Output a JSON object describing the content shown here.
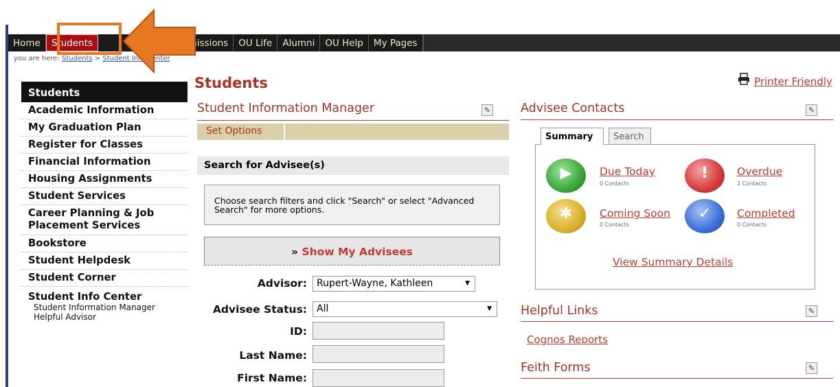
{
  "nav": {
    "items": [
      "Home",
      "Students",
      "Admissions",
      "OU Life",
      "Alumni",
      "OU Help",
      "My Pages"
    ]
  },
  "breadcrumb": {
    "prefix": "you are here:",
    "link1": "Students",
    "sep": ">",
    "link2": "Student Info Center"
  },
  "sidebar": {
    "items": [
      "Students",
      "Academic Information",
      "My Graduation Plan",
      "Register for Classes",
      "Financial Information",
      "Housing Assignments",
      "Student Services",
      "Career Planning & Job Placement Services",
      "Bookstore",
      "Student Helpdesk",
      "Student Corner",
      "Student Info Center"
    ],
    "subitems": [
      "Student Information Manager",
      "Helpful Advisor"
    ]
  },
  "page": {
    "title": "Students",
    "printer_label": "Printer Friendly"
  },
  "sim": {
    "title": "Student Information Manager",
    "set_options": "Set Options",
    "search_heading": "Search for Advisee(s)",
    "info_text": "Choose search filters and click \"Search\" or select \"Advanced Search\" for more options.",
    "show_label": "Show My Advisees",
    "show_chevron": "»",
    "advisor_label": "Advisor:",
    "advisor_value": "Rupert-Wayne, Kathleen",
    "status_label": "Advisee Status:",
    "status_value": "All",
    "id_label": "ID:",
    "last_label": "Last Name:",
    "first_label": "First Name:",
    "id_value": "",
    "last_value": "",
    "first_value": ""
  },
  "contacts": {
    "title": "Advisee Contacts",
    "tabs": [
      "Summary",
      "Search"
    ],
    "items": [
      {
        "label": "Due Today",
        "count": "0 Contacts",
        "color": "#3aa63a",
        "glyph": "▶"
      },
      {
        "label": "Overdue",
        "count": "2 Contacts",
        "color": "#d63a3a",
        "glyph": "!"
      },
      {
        "label": "Coming Soon",
        "count": "0 Contacts",
        "color": "#d9b02a",
        "glyph": "✱"
      },
      {
        "label": "Completed",
        "count": "0 Contacts",
        "color": "#3a6fd6",
        "glyph": "✓"
      }
    ],
    "summary_link": "View Summary Details"
  },
  "links": {
    "helpful_title": "Helpful Links",
    "cognos": "Cognos Reports",
    "feith_title": "Feith Forms"
  },
  "colors": {
    "accent": "#a83224",
    "nav_bg": "#1a1a1a",
    "active_tab": "#a80d14",
    "callout": "#e87722"
  }
}
